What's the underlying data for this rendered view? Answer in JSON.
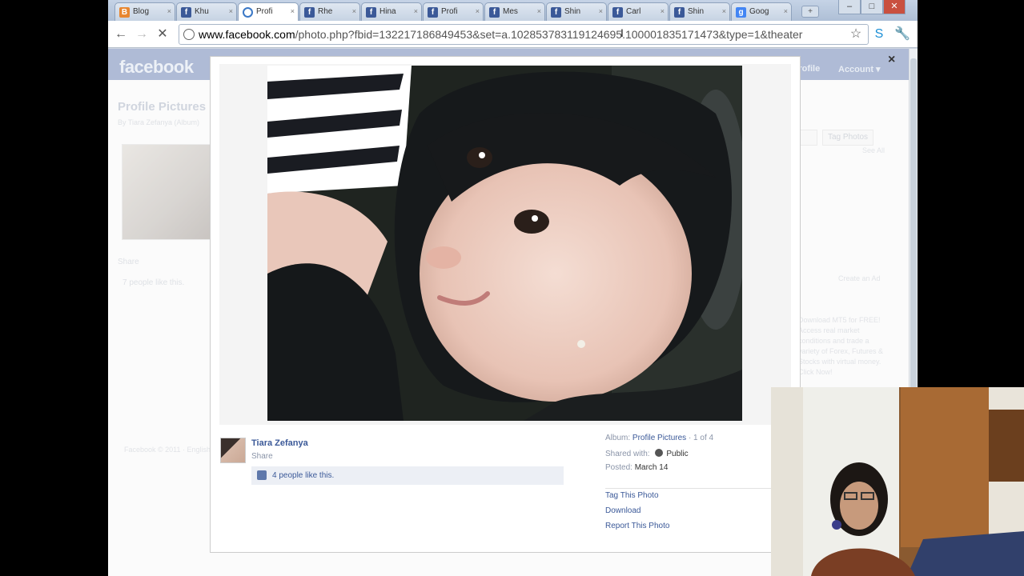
{
  "browser": {
    "tabs": [
      {
        "label": "Blog",
        "icon": "blogger-icon"
      },
      {
        "label": "Khu",
        "icon": "facebook-icon"
      },
      {
        "label": "Profi",
        "icon": "loading-icon",
        "active": true
      },
      {
        "label": "Rhe",
        "icon": "facebook-icon"
      },
      {
        "label": "Hina",
        "icon": "facebook-icon"
      },
      {
        "label": "Profi",
        "icon": "facebook-icon"
      },
      {
        "label": "Mes",
        "icon": "facebook-icon"
      },
      {
        "label": "Shin",
        "icon": "facebook-icon"
      },
      {
        "label": "Carl",
        "icon": "facebook-icon"
      },
      {
        "label": "Shin",
        "icon": "facebook-icon"
      },
      {
        "label": "Goog",
        "icon": "google-icon"
      }
    ],
    "url_host": "www.facebook.com",
    "url_path": "/photo.php?fbid=132217186849453&set=a.102853783119124695.100001835171473&type=1&theater"
  },
  "facebook": {
    "logo": "facebook",
    "nav_profile": "Profile",
    "nav_account": "Account ▾",
    "bg_title": "Profile Pictures",
    "bg_subtitle": "By Tiara Zefanya (Album)",
    "bg_share": "Share",
    "bg_likes": "7 people like this.",
    "bg_tag_button": "Tag Photos",
    "bg_see_all": "See All",
    "bg_create_ad": "Create an Ad",
    "bg_ad_text": "Download MT5 for FREE! Access real market conditions and trade a variety of Forex, Futures & Stocks with virtual money. Click Now!",
    "bg_footer": "Facebook © 2011 · English"
  },
  "photo_viewer": {
    "owner_name": "Tiara Zefanya",
    "share_label": "Share",
    "likes_text": "4 people like this.",
    "album_label": "Album:",
    "album_name": "Profile Pictures",
    "album_position": "· 1 of 4",
    "shared_with_label": "Shared with:",
    "shared_with_value": "Public",
    "posted_label": "Posted:",
    "posted_value": "March 14",
    "action_tag": "Tag This Photo",
    "action_download": "Download",
    "action_report": "Report This Photo",
    "close_glyph": "×"
  }
}
